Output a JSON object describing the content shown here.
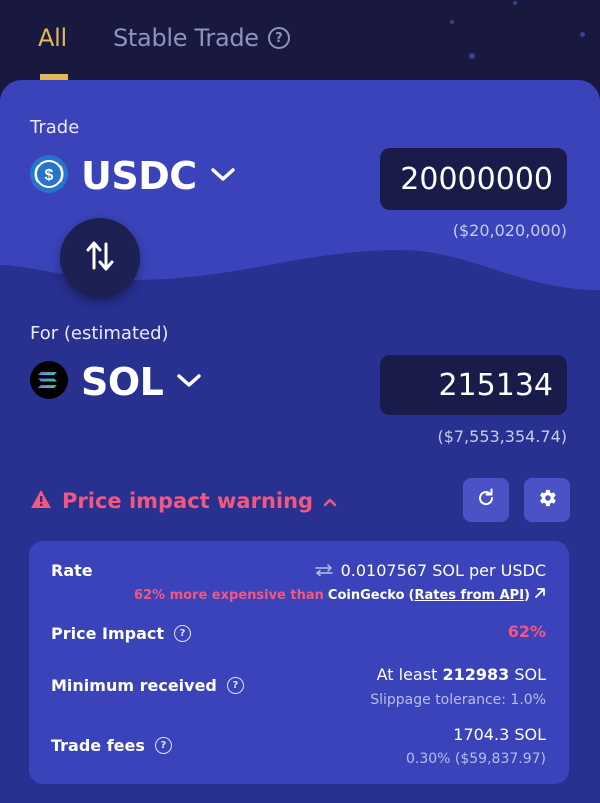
{
  "tabs": {
    "all_label": "All",
    "stable_label": "Stable Trade",
    "help_glyph": "?"
  },
  "trade": {
    "label": "Trade",
    "token": "USDC",
    "amount": "20000000",
    "usd_value": "($20,020,000)"
  },
  "receive": {
    "label": "For (estimated)",
    "token": "SOL",
    "amount": "215134",
    "usd_value": "($7,553,354.74)"
  },
  "warning": {
    "text": "Price impact warning"
  },
  "details": {
    "rate_label": "Rate",
    "rate_value": "0.0107567 SOL per USDC",
    "rate_compare_pct": "62% more expensive than",
    "rate_compare_src": "CoinGecko",
    "rate_api_link": "Rates from API",
    "price_impact_label": "Price Impact",
    "price_impact_value": "62%",
    "min_received_label": "Minimum received",
    "min_received_prefix": "At least",
    "min_received_amount": "212983",
    "min_received_unit": "SOL",
    "slippage": "Slippage tolerance: 1.0%",
    "fees_label": "Trade fees",
    "fees_value": "1704.3 SOL",
    "fees_sub": "0.30% ($59,837.97)"
  },
  "colors": {
    "background": "#19193f",
    "card": "#283090",
    "accent_gold": "#e2b75a",
    "warning_pink": "#f2577f",
    "panel": "#3a43b9",
    "button": "#4b52c6"
  },
  "icons": {
    "usdc": "usdc-token-icon",
    "sol": "sol-token-icon",
    "swap": "swap-arrows-icon",
    "warning": "warning-triangle-icon",
    "refresh": "refresh-icon",
    "settings": "gear-icon",
    "external": "external-link-icon",
    "swap_rate": "swap-direction-icon"
  }
}
